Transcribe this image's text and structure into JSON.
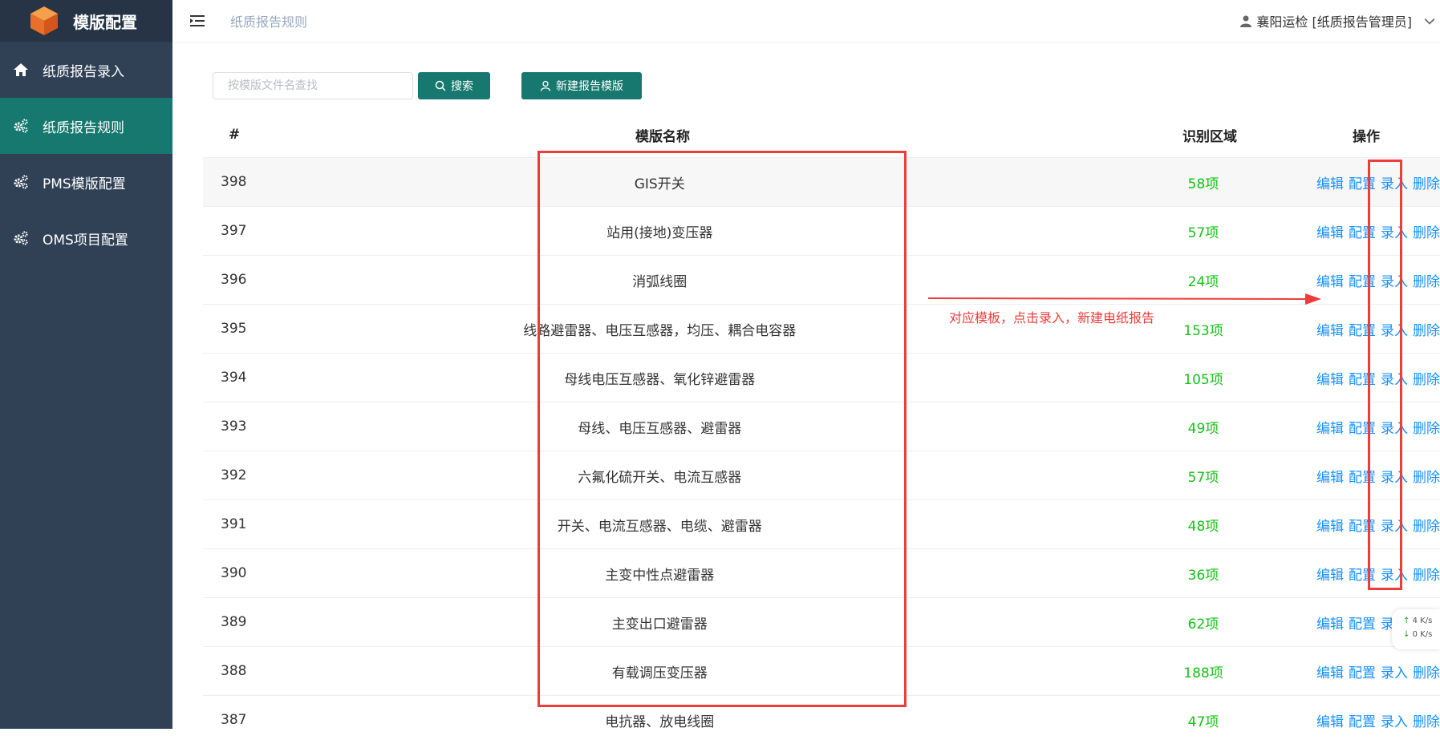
{
  "app": {
    "title": "模版配置"
  },
  "sidebar": {
    "items": [
      {
        "label": "纸质报告录入",
        "icon": "home-icon",
        "active": false
      },
      {
        "label": "纸质报告规则",
        "icon": "gears-icon",
        "active": true
      },
      {
        "label": "PMS模版配置",
        "icon": "gears-icon",
        "active": false
      },
      {
        "label": "OMS项目配置",
        "icon": "gears-icon",
        "active": false
      }
    ]
  },
  "header": {
    "breadcrumb": "纸质报告规则",
    "user": "襄阳运检 [纸质报告管理员]"
  },
  "toolbar": {
    "search_placeholder": "按模版文件名查找",
    "search_value": "",
    "search_label": "搜索",
    "new_label": "新建报告模版"
  },
  "table": {
    "headers": {
      "idx": "#",
      "name": "模版名称",
      "area": "识别区域",
      "ops": "操作"
    },
    "op_labels": {
      "edit": "编辑",
      "config": "配置",
      "enter": "录入",
      "delete": "删除"
    },
    "rows": [
      {
        "idx": "398",
        "name": "GIS开关",
        "area": "58项"
      },
      {
        "idx": "397",
        "name": "站用(接地)变压器",
        "area": "57项"
      },
      {
        "idx": "396",
        "name": "消弧线圈",
        "area": "24项"
      },
      {
        "idx": "395",
        "name": "线路避雷器、电压互感器，均压、耦合电容器",
        "area": "153项"
      },
      {
        "idx": "394",
        "name": "母线电压互感器、氧化锌避雷器",
        "area": "105项"
      },
      {
        "idx": "393",
        "name": "母线、电压互感器、避雷器",
        "area": "49项"
      },
      {
        "idx": "392",
        "name": "六氟化硫开关、电流互感器",
        "area": "57项"
      },
      {
        "idx": "391",
        "name": "开关、电流互感器、电缆、避雷器",
        "area": "48项"
      },
      {
        "idx": "390",
        "name": "主变中性点避雷器",
        "area": "36项"
      },
      {
        "idx": "389",
        "name": "主变出口避雷器",
        "area": "62项"
      },
      {
        "idx": "388",
        "name": "有载调压变压器",
        "area": "188项"
      },
      {
        "idx": "387",
        "name": "电抗器、放电线圈",
        "area": "47项"
      }
    ]
  },
  "annotation": {
    "text": "对应模板，点击录入，新建电纸报告",
    "color": "#ee3b3b"
  },
  "net_speed": {
    "up": "4",
    "down": "0",
    "unit": "K/s"
  },
  "colors": {
    "sidebar": "#304156",
    "accent": "#16786e",
    "link": "#1890ff",
    "count": "#13c213"
  }
}
